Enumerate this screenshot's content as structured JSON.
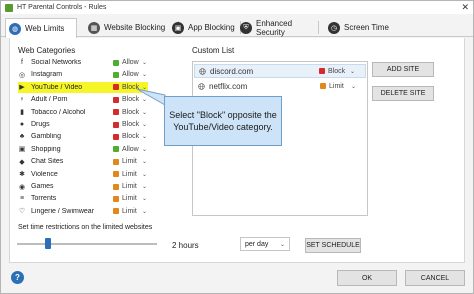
{
  "window": {
    "title": "HT Parental Controls - Rules",
    "close_glyph": "✕"
  },
  "tabs": [
    {
      "label": "Web Limits",
      "icon": "globe-icon",
      "color": "#2f6db5",
      "active": true
    },
    {
      "label": "Website Blocking",
      "icon": "website-blocking-icon",
      "color": "#555555",
      "active": false
    },
    {
      "label": "App Blocking",
      "icon": "app-blocking-icon",
      "color": "#333333",
      "active": false
    },
    {
      "label": "Enhanced Security",
      "icon": "shield-icon",
      "color": "#333333",
      "active": false
    },
    {
      "label": "Screen Time",
      "icon": "clock-icon",
      "color": "#333333",
      "active": false
    }
  ],
  "web_categories": {
    "title": "Web Categories",
    "items": [
      {
        "label": "Social Networks",
        "status": "Allow",
        "icon": "social-networks-icon",
        "glyph": "f"
      },
      {
        "label": "Instagram",
        "status": "Allow",
        "icon": "instagram-icon",
        "glyph": "◎"
      },
      {
        "label": "YouTube / Video",
        "status": "Block",
        "icon": "youtube-icon",
        "glyph": "▶"
      },
      {
        "label": "Adult / Porn",
        "status": "Block",
        "icon": "adult-icon",
        "glyph": "♀"
      },
      {
        "label": "Tobacco / Alcohol",
        "status": "Block",
        "icon": "tobacco-icon",
        "glyph": "▮"
      },
      {
        "label": "Drugs",
        "status": "Block",
        "icon": "drugs-icon",
        "glyph": "●"
      },
      {
        "label": "Gambling",
        "status": "Block",
        "icon": "gambling-icon",
        "glyph": "♣"
      },
      {
        "label": "Shopping",
        "status": "Allow",
        "icon": "shopping-icon",
        "glyph": "▣"
      },
      {
        "label": "Chat Sites",
        "status": "Limit",
        "icon": "chat-icon",
        "glyph": "◆"
      },
      {
        "label": "Violence",
        "status": "Limit",
        "icon": "violence-icon",
        "glyph": "✱"
      },
      {
        "label": "Games",
        "status": "Limit",
        "icon": "games-icon",
        "glyph": "◉"
      },
      {
        "label": "Torrents",
        "status": "Limit",
        "icon": "torrents-icon",
        "glyph": "≡"
      },
      {
        "label": "Lingerie / Swimwear",
        "status": "Limit",
        "icon": "lingerie-icon",
        "glyph": "♡"
      }
    ]
  },
  "status_colors": {
    "Allow": "#4caf30",
    "Block": "#d62b2b",
    "Limit": "#e08a1e"
  },
  "custom_list": {
    "title": "Custom List",
    "items": [
      {
        "site": "discord.com",
        "status": "Block",
        "icon": "globe-icon",
        "selected": true
      },
      {
        "site": "netflix.com",
        "status": "Limit",
        "icon": "globe-icon",
        "selected": false
      }
    ],
    "add_label": "ADD SITE",
    "delete_label": "DELETE SITE"
  },
  "tooltip": {
    "text": "Select \"Block\" opposite the YouTube/Video category."
  },
  "time_limit": {
    "label": "Set time restrictions on the limited websites",
    "value": "2 hours",
    "level_fraction": 0.22,
    "period": "per day",
    "schedule_label": "SET SCHEDULE"
  },
  "footer": {
    "help_glyph": "?",
    "ok_label": "OK",
    "cancel_label": "CANCEL"
  },
  "chevron_glyph": "⌄"
}
